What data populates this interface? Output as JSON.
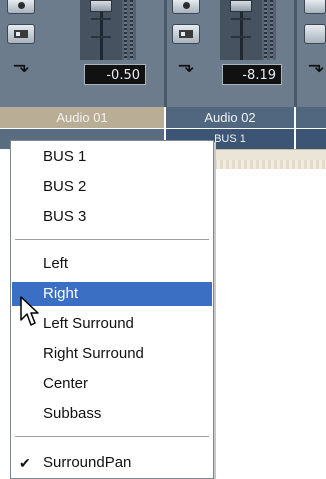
{
  "mixer": {
    "channels": [
      {
        "name": "Audio 01",
        "value": "-0.50"
      },
      {
        "name": "Audio 02",
        "value": "-8.19",
        "route": "BUS 1"
      }
    ]
  },
  "menu": {
    "items": [
      {
        "label": "BUS 1"
      },
      {
        "label": "BUS 2"
      },
      {
        "label": "BUS 3"
      },
      {
        "label": "Left"
      },
      {
        "label": "Right",
        "selected": true
      },
      {
        "label": "Left Surround"
      },
      {
        "label": "Right Surround"
      },
      {
        "label": "Center"
      },
      {
        "label": "Subbass"
      },
      {
        "label": "SurroundPan",
        "checked": true
      }
    ]
  },
  "icons": {
    "record": "record-icon",
    "insert": "insert-icon",
    "automation": "automation-icon",
    "checkmark": "checkmark-icon",
    "cursor": "mouse-pointer-icon"
  },
  "colors": {
    "selection": "#3a6fc4",
    "mixer_panel": "#6c7c8c",
    "name_bar_active": "#b9ad95",
    "name_bar": "#50677f",
    "route_bar": "#3c5575",
    "value_display": "#111111"
  }
}
